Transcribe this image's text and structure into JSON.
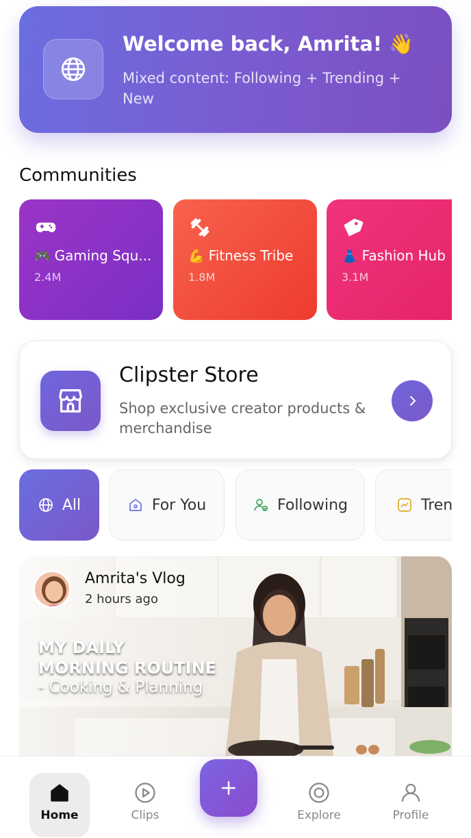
{
  "welcome": {
    "title": "Welcome back, Amrita! 👋",
    "subtitle": "Mixed content: Following + Trending + New",
    "icon": "globe-icon"
  },
  "communities": {
    "heading": "Communities",
    "items": [
      {
        "emoji": "🎮",
        "name": "Gaming Squ...",
        "count": "2.4M",
        "icon": "gamepad-icon",
        "color": "#8e30c8"
      },
      {
        "emoji": "💪",
        "name": "Fitness Tribe",
        "count": "1.8M",
        "icon": "dumbbell-icon",
        "color": "#f04a3a"
      },
      {
        "emoji": "👗",
        "name": "Fashion Hub",
        "count": "3.1M",
        "icon": "tag-icon",
        "color": "#ea2b72"
      }
    ]
  },
  "store": {
    "title": "Clipster Store",
    "description": "Shop exclusive creator products & merchandise",
    "icon": "storefront-icon"
  },
  "filters": {
    "items": [
      {
        "label": "All",
        "icon": "globe-icon",
        "active": true
      },
      {
        "label": "For You",
        "icon": "home-heart-icon",
        "active": false
      },
      {
        "label": "Following",
        "icon": "user-follow-icon",
        "active": false
      },
      {
        "label": "Trending",
        "icon": "trending-icon",
        "active": false
      }
    ]
  },
  "post": {
    "author": "Amrita's Vlog",
    "time": "2 hours ago",
    "headline_line1": "MY DAILY",
    "headline_line2": "MORNING ROUTINE",
    "subhead": "- Cooking & Planning"
  },
  "nav": {
    "home": "Home",
    "clips": "Clips",
    "explore": "Explore",
    "profile": "Profile",
    "active": "home"
  },
  "colors": {
    "accent": "#7063d8",
    "accent2": "#7b58c9"
  }
}
